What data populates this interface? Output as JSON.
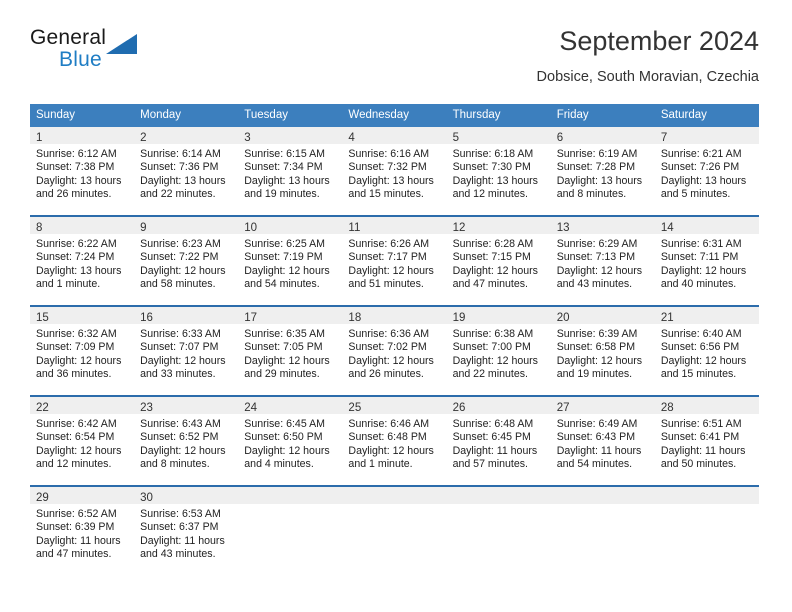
{
  "logo": {
    "word_top": "General",
    "word_bottom": "Blue",
    "triangle_icon": "blue-triangle-icon",
    "accent_color": "#1f6cb0"
  },
  "header": {
    "title": "September 2024",
    "subtitle": "Dobsice, South Moravian, Czechia"
  },
  "theme": {
    "header_blue": "#3c7fbe",
    "separator_blue": "#2c6cab",
    "day_band_gray": "#efefef"
  },
  "weekdays": [
    "Sunday",
    "Monday",
    "Tuesday",
    "Wednesday",
    "Thursday",
    "Friday",
    "Saturday"
  ],
  "weeks": [
    [
      {
        "day": "1",
        "sunrise": "Sunrise: 6:12 AM",
        "sunset": "Sunset: 7:38 PM",
        "daylight_1": "Daylight: 13 hours",
        "daylight_2": "and 26 minutes."
      },
      {
        "day": "2",
        "sunrise": "Sunrise: 6:14 AM",
        "sunset": "Sunset: 7:36 PM",
        "daylight_1": "Daylight: 13 hours",
        "daylight_2": "and 22 minutes."
      },
      {
        "day": "3",
        "sunrise": "Sunrise: 6:15 AM",
        "sunset": "Sunset: 7:34 PM",
        "daylight_1": "Daylight: 13 hours",
        "daylight_2": "and 19 minutes."
      },
      {
        "day": "4",
        "sunrise": "Sunrise: 6:16 AM",
        "sunset": "Sunset: 7:32 PM",
        "daylight_1": "Daylight: 13 hours",
        "daylight_2": "and 15 minutes."
      },
      {
        "day": "5",
        "sunrise": "Sunrise: 6:18 AM",
        "sunset": "Sunset: 7:30 PM",
        "daylight_1": "Daylight: 13 hours",
        "daylight_2": "and 12 minutes."
      },
      {
        "day": "6",
        "sunrise": "Sunrise: 6:19 AM",
        "sunset": "Sunset: 7:28 PM",
        "daylight_1": "Daylight: 13 hours",
        "daylight_2": "and 8 minutes."
      },
      {
        "day": "7",
        "sunrise": "Sunrise: 6:21 AM",
        "sunset": "Sunset: 7:26 PM",
        "daylight_1": "Daylight: 13 hours",
        "daylight_2": "and 5 minutes."
      }
    ],
    [
      {
        "day": "8",
        "sunrise": "Sunrise: 6:22 AM",
        "sunset": "Sunset: 7:24 PM",
        "daylight_1": "Daylight: 13 hours",
        "daylight_2": "and 1 minute."
      },
      {
        "day": "9",
        "sunrise": "Sunrise: 6:23 AM",
        "sunset": "Sunset: 7:22 PM",
        "daylight_1": "Daylight: 12 hours",
        "daylight_2": "and 58 minutes."
      },
      {
        "day": "10",
        "sunrise": "Sunrise: 6:25 AM",
        "sunset": "Sunset: 7:19 PM",
        "daylight_1": "Daylight: 12 hours",
        "daylight_2": "and 54 minutes."
      },
      {
        "day": "11",
        "sunrise": "Sunrise: 6:26 AM",
        "sunset": "Sunset: 7:17 PM",
        "daylight_1": "Daylight: 12 hours",
        "daylight_2": "and 51 minutes."
      },
      {
        "day": "12",
        "sunrise": "Sunrise: 6:28 AM",
        "sunset": "Sunset: 7:15 PM",
        "daylight_1": "Daylight: 12 hours",
        "daylight_2": "and 47 minutes."
      },
      {
        "day": "13",
        "sunrise": "Sunrise: 6:29 AM",
        "sunset": "Sunset: 7:13 PM",
        "daylight_1": "Daylight: 12 hours",
        "daylight_2": "and 43 minutes."
      },
      {
        "day": "14",
        "sunrise": "Sunrise: 6:31 AM",
        "sunset": "Sunset: 7:11 PM",
        "daylight_1": "Daylight: 12 hours",
        "daylight_2": "and 40 minutes."
      }
    ],
    [
      {
        "day": "15",
        "sunrise": "Sunrise: 6:32 AM",
        "sunset": "Sunset: 7:09 PM",
        "daylight_1": "Daylight: 12 hours",
        "daylight_2": "and 36 minutes."
      },
      {
        "day": "16",
        "sunrise": "Sunrise: 6:33 AM",
        "sunset": "Sunset: 7:07 PM",
        "daylight_1": "Daylight: 12 hours",
        "daylight_2": "and 33 minutes."
      },
      {
        "day": "17",
        "sunrise": "Sunrise: 6:35 AM",
        "sunset": "Sunset: 7:05 PM",
        "daylight_1": "Daylight: 12 hours",
        "daylight_2": "and 29 minutes."
      },
      {
        "day": "18",
        "sunrise": "Sunrise: 6:36 AM",
        "sunset": "Sunset: 7:02 PM",
        "daylight_1": "Daylight: 12 hours",
        "daylight_2": "and 26 minutes."
      },
      {
        "day": "19",
        "sunrise": "Sunrise: 6:38 AM",
        "sunset": "Sunset: 7:00 PM",
        "daylight_1": "Daylight: 12 hours",
        "daylight_2": "and 22 minutes."
      },
      {
        "day": "20",
        "sunrise": "Sunrise: 6:39 AM",
        "sunset": "Sunset: 6:58 PM",
        "daylight_1": "Daylight: 12 hours",
        "daylight_2": "and 19 minutes."
      },
      {
        "day": "21",
        "sunrise": "Sunrise: 6:40 AM",
        "sunset": "Sunset: 6:56 PM",
        "daylight_1": "Daylight: 12 hours",
        "daylight_2": "and 15 minutes."
      }
    ],
    [
      {
        "day": "22",
        "sunrise": "Sunrise: 6:42 AM",
        "sunset": "Sunset: 6:54 PM",
        "daylight_1": "Daylight: 12 hours",
        "daylight_2": "and 12 minutes."
      },
      {
        "day": "23",
        "sunrise": "Sunrise: 6:43 AM",
        "sunset": "Sunset: 6:52 PM",
        "daylight_1": "Daylight: 12 hours",
        "daylight_2": "and 8 minutes."
      },
      {
        "day": "24",
        "sunrise": "Sunrise: 6:45 AM",
        "sunset": "Sunset: 6:50 PM",
        "daylight_1": "Daylight: 12 hours",
        "daylight_2": "and 4 minutes."
      },
      {
        "day": "25",
        "sunrise": "Sunrise: 6:46 AM",
        "sunset": "Sunset: 6:48 PM",
        "daylight_1": "Daylight: 12 hours",
        "daylight_2": "and 1 minute."
      },
      {
        "day": "26",
        "sunrise": "Sunrise: 6:48 AM",
        "sunset": "Sunset: 6:45 PM",
        "daylight_1": "Daylight: 11 hours",
        "daylight_2": "and 57 minutes."
      },
      {
        "day": "27",
        "sunrise": "Sunrise: 6:49 AM",
        "sunset": "Sunset: 6:43 PM",
        "daylight_1": "Daylight: 11 hours",
        "daylight_2": "and 54 minutes."
      },
      {
        "day": "28",
        "sunrise": "Sunrise: 6:51 AM",
        "sunset": "Sunset: 6:41 PM",
        "daylight_1": "Daylight: 11 hours",
        "daylight_2": "and 50 minutes."
      }
    ],
    [
      {
        "day": "29",
        "sunrise": "Sunrise: 6:52 AM",
        "sunset": "Sunset: 6:39 PM",
        "daylight_1": "Daylight: 11 hours",
        "daylight_2": "and 47 minutes."
      },
      {
        "day": "30",
        "sunrise": "Sunrise: 6:53 AM",
        "sunset": "Sunset: 6:37 PM",
        "daylight_1": "Daylight: 11 hours",
        "daylight_2": "and 43 minutes."
      },
      {
        "day": "",
        "sunrise": "",
        "sunset": "",
        "daylight_1": "",
        "daylight_2": ""
      },
      {
        "day": "",
        "sunrise": "",
        "sunset": "",
        "daylight_1": "",
        "daylight_2": ""
      },
      {
        "day": "",
        "sunrise": "",
        "sunset": "",
        "daylight_1": "",
        "daylight_2": ""
      },
      {
        "day": "",
        "sunrise": "",
        "sunset": "",
        "daylight_1": "",
        "daylight_2": ""
      },
      {
        "day": "",
        "sunrise": "",
        "sunset": "",
        "daylight_1": "",
        "daylight_2": ""
      }
    ]
  ]
}
